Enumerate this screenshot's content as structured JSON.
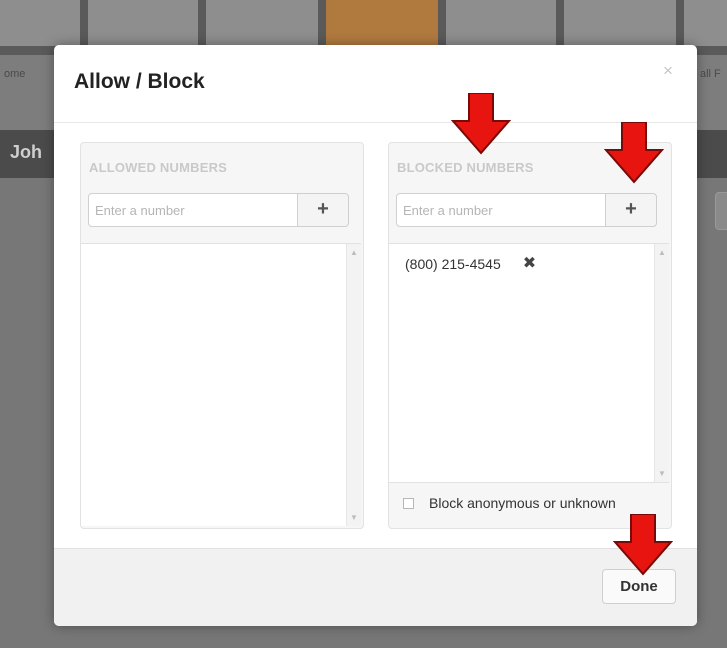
{
  "background": {
    "nav_labels": [
      "ome",
      "all F"
    ],
    "bar_text": "Joh"
  },
  "modal": {
    "title": "Allow / Block",
    "close_symbol": "×"
  },
  "allowed": {
    "title": "ALLOWED NUMBERS",
    "input_placeholder": "Enter a number",
    "add_symbol": "+",
    "items": []
  },
  "blocked": {
    "title": "BLOCKED NUMBERS",
    "input_placeholder": "Enter a number",
    "add_symbol": "+",
    "items": [
      {
        "number": "(800) 215-4545",
        "remove_symbol": "✖"
      }
    ],
    "anonymous_label": "Block anonymous or unknown",
    "anonymous_checked": false
  },
  "footer": {
    "done_label": "Done"
  },
  "colors": {
    "annotation_arrow": "#e8140f",
    "active_nav": "#b07a3f"
  },
  "icons": {
    "scroll_up": "▲",
    "scroll_down": "▼"
  }
}
